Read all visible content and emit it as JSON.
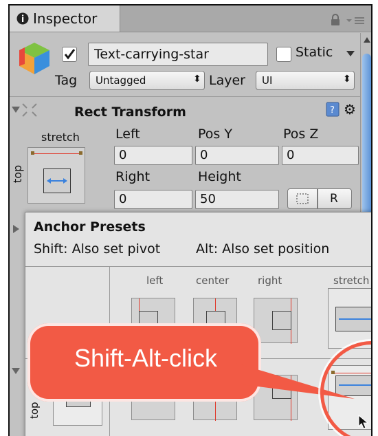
{
  "tab": {
    "title": "Inspector"
  },
  "object": {
    "name": "Text-carrying-star",
    "active": true,
    "static_label": "Static",
    "static_checked": false
  },
  "tag": {
    "label": "Tag",
    "value": "Untagged"
  },
  "layer": {
    "label": "Layer",
    "value": "UI"
  },
  "rect_transform": {
    "title": "Rect Transform",
    "anchor_h_label": "stretch",
    "anchor_v_label": "top",
    "row1_labels": [
      "Left",
      "Pos Y",
      "Pos Z"
    ],
    "row1_values": [
      "0",
      "0",
      "0"
    ],
    "row2_labels": [
      "Right",
      "Height"
    ],
    "row2_values": [
      "0",
      "50"
    ],
    "r_button": "R"
  },
  "anchor_presets": {
    "title": "Anchor Presets",
    "hint_shift": "Shift: Also set pivot",
    "hint_alt": "Alt: Also set position",
    "columns": [
      "left",
      "center",
      "right",
      "stretch"
    ],
    "row_labels": [
      "top"
    ]
  },
  "callout": {
    "text": "Shift-Alt-click"
  },
  "colors": {
    "callout": "#f25a45",
    "anchor_red": "#e0392b",
    "anchor_blue": "#3b82dd"
  }
}
